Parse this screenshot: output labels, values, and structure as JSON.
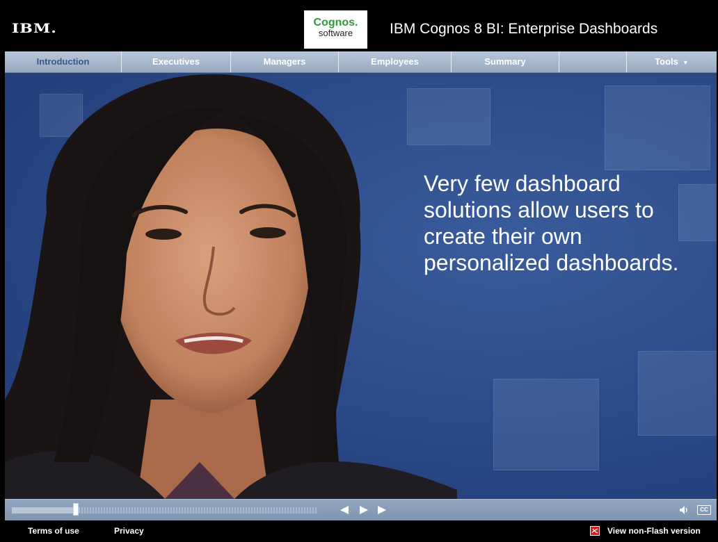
{
  "header": {
    "logo_text": "IBM.",
    "brand_line1": "Cognos.",
    "brand_line2": "software",
    "title": "IBM Cognos 8 BI: Enterprise Dashboards"
  },
  "nav": {
    "tabs": [
      {
        "label": "Introduction",
        "active": true
      },
      {
        "label": "Executives",
        "active": false
      },
      {
        "label": "Managers",
        "active": false
      },
      {
        "label": "Employees",
        "active": false
      },
      {
        "label": "Summary",
        "active": false
      },
      {
        "label": "",
        "active": false
      }
    ],
    "tools_label": "Tools",
    "tools_caret": "▼"
  },
  "stage": {
    "quote": "Very few dashboard solutions allow users to create their own personalized dashboards."
  },
  "controls": {
    "progress": 0.21,
    "icons": [
      "previous-icon",
      "play-icon",
      "next-icon",
      "volume-icon",
      "closed-caption-icon"
    ],
    "cc_label": "CC"
  },
  "footer": {
    "terms": "Terms of use",
    "privacy": "Privacy",
    "non_flash": "View non-Flash version"
  },
  "colors": {
    "nav_bg": "#a9b8cd",
    "stage_bg": "#2a4786",
    "brand_green": "#2f9a3a",
    "pdf_red": "#d0201c"
  }
}
